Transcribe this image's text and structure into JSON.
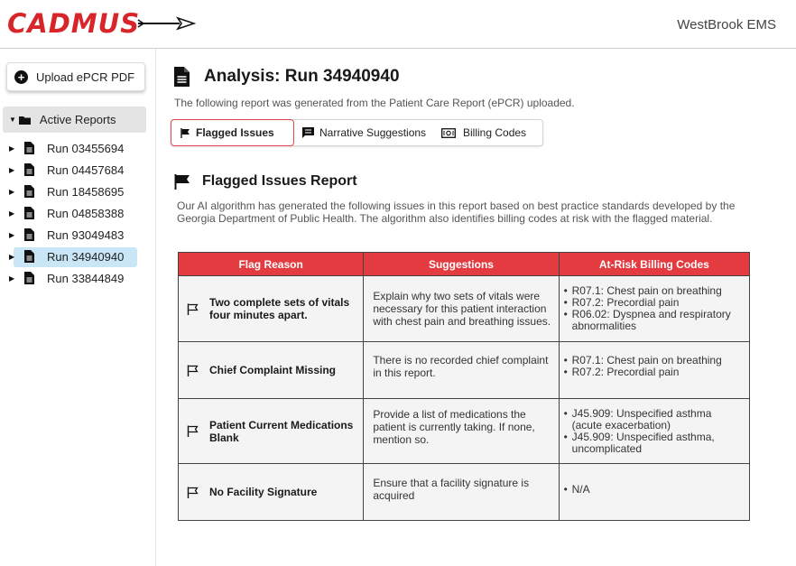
{
  "header": {
    "logo_text": "CADMUS",
    "org_name": "WestBrook EMS"
  },
  "sidebar": {
    "upload_label": "Upload ePCR PDF",
    "folder_label": "Active Reports",
    "runs": [
      {
        "label": "Run 03455694",
        "active": false
      },
      {
        "label": "Run 04457684",
        "active": false
      },
      {
        "label": "Run 18458695",
        "active": false
      },
      {
        "label": "Run 04858388",
        "active": false
      },
      {
        "label": "Run 93049483",
        "active": false
      },
      {
        "label": "Run 34940940",
        "active": true
      },
      {
        "label": "Run 33844849",
        "active": false
      }
    ]
  },
  "main": {
    "title": "Analysis: Run 34940940",
    "subtitle": "The following report was generated from the Patient Care Report (ePCR) uploaded.",
    "tabs": [
      {
        "label": "Flagged Issues",
        "icon": "flag-icon",
        "active": true
      },
      {
        "label": "Narrative Suggestions",
        "icon": "message-icon",
        "active": false
      },
      {
        "label": "Billing Codes",
        "icon": "money-icon",
        "active": false
      }
    ],
    "section_title": "Flagged Issues Report",
    "section_desc": "Our AI algorithm has generated the following issues in this report based on best practice standards developed by the Georgia Department of Public Health. The algorithm also identifies billing codes at risk with the flagged material.",
    "table": {
      "headers": [
        "Flag Reason",
        "Suggestions",
        "At-Risk Billing Codes"
      ],
      "rows": [
        {
          "reason": "Two complete sets of vitals four minutes apart.",
          "suggestion": "Explain why two sets of vitals were necessary for this patient interaction with chest pain and breathing issues.",
          "codes": [
            "R07.1: Chest pain on breathing",
            "R07.2: Precordial pain",
            "R06.02: Dyspnea and respiratory abnormalities"
          ]
        },
        {
          "reason": "Chief Complaint Missing",
          "suggestion": "There is no recorded chief complaint in this report.",
          "codes": [
            "R07.1: Chest pain on breathing",
            "R07.2: Precordial pain"
          ]
        },
        {
          "reason": "Patient Current Medications Blank",
          "suggestion": "Provide a list of medications the patient is currently taking. If none, mention so.",
          "codes": [
            "J45.909: Unspecified asthma (acute exacerbation)",
            "J45.909: Unspecified asthma, uncomplicated"
          ]
        },
        {
          "reason": "No Facility Signature",
          "suggestion": "Ensure that a facility signature is acquired",
          "codes": [
            "N/A"
          ]
        }
      ]
    }
  },
  "colors": {
    "brand_red": "#d8252a",
    "table_header": "#e43b40",
    "active_run_highlight": "#c9e6f6",
    "active_tab_border": "#e2474b"
  }
}
